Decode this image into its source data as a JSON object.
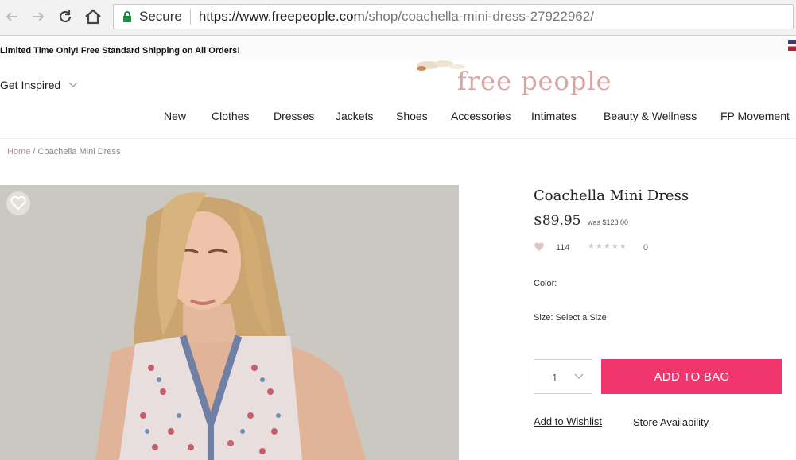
{
  "browser": {
    "secure_label": "Secure",
    "url_main": "https://www.freepeople.com",
    "url_path": "/shop/coachella-mini-dress-27922962/"
  },
  "promo": {
    "text": "Limited Time Only! Free Standard Shipping on All Orders!"
  },
  "header": {
    "get_inspired": "Get Inspired",
    "logo": "free people",
    "nav": [
      "New",
      "Clothes",
      "Dresses",
      "Jackets",
      "Shoes",
      "Accessories",
      "Intimates",
      "Beauty & Wellness",
      "FP Movement"
    ]
  },
  "breadcrumb": {
    "home": "Home",
    "separator": "/",
    "current": "Coachella Mini Dress"
  },
  "product": {
    "title": "Coachella Mini Dress",
    "price": "$89.95",
    "was_price": "was $128.00",
    "favorites": "114",
    "reviews": "0",
    "stars": "★★★★★",
    "color_label": "Color:",
    "size_label": "Size: Select a Size",
    "quantity": "1",
    "add_to_bag": "ADD TO BAG",
    "add_to_wishlist": "Add to Wishlist",
    "store_availability": "Store Availability"
  },
  "colors": {
    "accent": "#f1356d",
    "logo": "#d7a6a2",
    "breadcrumb_home": "#b28e92"
  }
}
